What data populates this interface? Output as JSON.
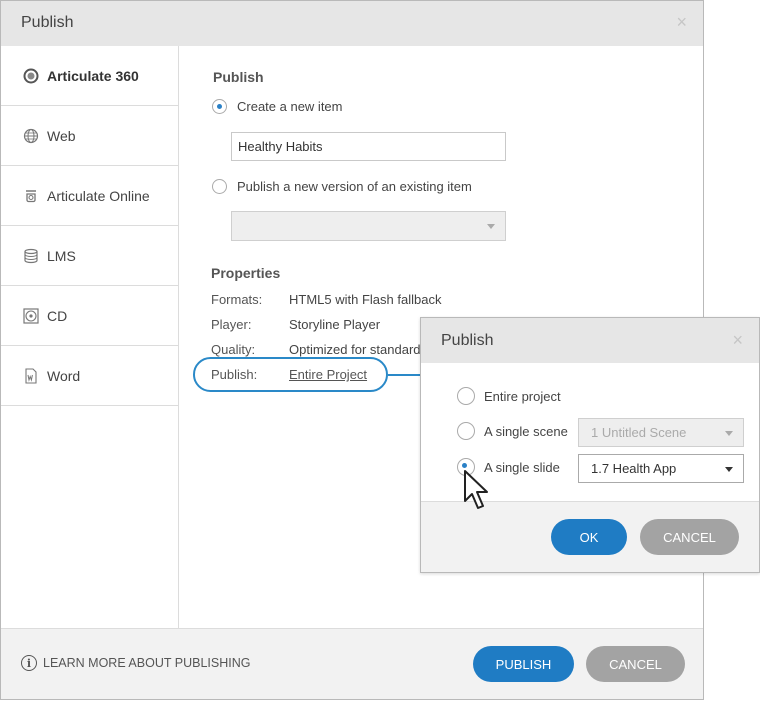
{
  "main_dialog": {
    "title": "Publish",
    "close_glyph": "×",
    "sidebar": [
      {
        "label": "Articulate 360",
        "icon": "articulate-360-icon",
        "active": true
      },
      {
        "label": "Web",
        "icon": "globe-icon",
        "active": false
      },
      {
        "label": "Articulate Online",
        "icon": "articulate-online-icon",
        "active": false
      },
      {
        "label": "LMS",
        "icon": "database-icon",
        "active": false
      },
      {
        "label": "CD",
        "icon": "disc-icon",
        "active": false
      },
      {
        "label": "Word",
        "icon": "word-document-icon",
        "active": false
      }
    ],
    "publish_section": {
      "heading": "Publish",
      "option_new": "Create a new item",
      "new_item_name": "Healthy Habits",
      "option_existing": "Publish a new version of an existing item",
      "existing_item_value": ""
    },
    "properties": {
      "heading": "Properties",
      "rows": [
        {
          "label": "Formats:",
          "value": "HTML5 with Flash fallback"
        },
        {
          "label": "Player:",
          "value": "Storyline Player"
        },
        {
          "label": "Quality:",
          "value": "Optimized for standard"
        },
        {
          "label": "Publish:",
          "value": "Entire Project"
        }
      ]
    },
    "footer": {
      "learn_more": "LEARN MORE ABOUT PUBLISHING",
      "info_glyph": "i",
      "publish_button": "PUBLISH",
      "cancel_button": "CANCEL"
    }
  },
  "sub_dialog": {
    "title": "Publish",
    "close_glyph": "×",
    "options": [
      {
        "label": "Entire project",
        "checked": false
      },
      {
        "label": "A single scene",
        "checked": false
      },
      {
        "label": "A single slide",
        "checked": true
      }
    ],
    "scene_dropdown": "1 Untitled Scene",
    "slide_dropdown": "1.7 Health App",
    "ok_button": "OK",
    "cancel_button": "CANCEL"
  },
  "colors": {
    "accent": "#1f7cc4",
    "callout": "#2a89c8",
    "secondary_button": "#a3a3a3",
    "titlebar": "#e6e6e6"
  }
}
